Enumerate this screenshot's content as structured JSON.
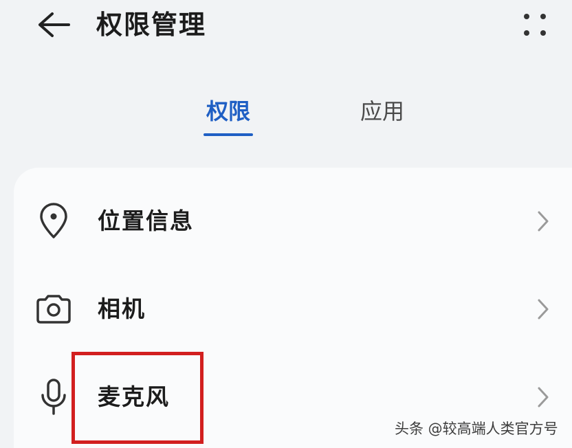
{
  "header": {
    "title": "权限管理",
    "back_icon": "arrow-left-icon",
    "more_icon": "more-dots-icon"
  },
  "tabs": [
    {
      "label": "权限",
      "active": true
    },
    {
      "label": "应用",
      "active": false
    }
  ],
  "accent_color": "#1f5fc4",
  "highlight_color": "#d21f1f",
  "permissions": [
    {
      "label": "位置信息",
      "icon": "location-pin-icon"
    },
    {
      "label": "相机",
      "icon": "camera-icon"
    },
    {
      "label": "麦克风",
      "icon": "microphone-icon"
    }
  ],
  "watermark": "头条 @较高端人类官方号"
}
